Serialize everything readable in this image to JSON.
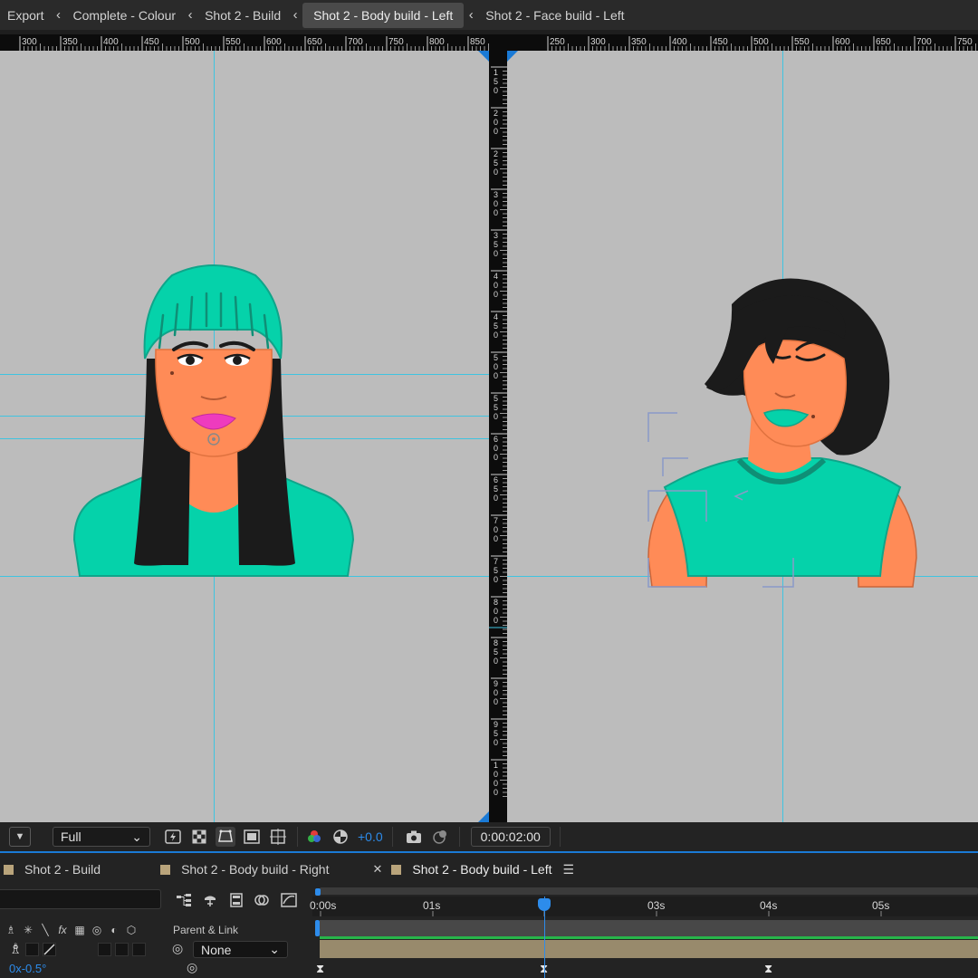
{
  "breadcrumbs": [
    {
      "label": "Export"
    },
    {
      "label": "Complete - Colour"
    },
    {
      "label": "Shot 2 - Build"
    },
    {
      "label": "Shot 2 - Body build - Left"
    },
    {
      "label": "Shot 2 - Face build - Left"
    }
  ],
  "rulers": {
    "left_top_ticks": [
      "300",
      "350",
      "400",
      "450",
      "500",
      "550",
      "600",
      "650",
      "700",
      "750",
      "800",
      "850"
    ],
    "right_top_ticks": [
      "250",
      "300",
      "350",
      "400",
      "450",
      "500",
      "550",
      "600",
      "650",
      "700",
      "750"
    ],
    "vertical_ticks": [
      "150",
      "200",
      "250",
      "300",
      "350",
      "400",
      "450",
      "500",
      "550",
      "600",
      "650",
      "700",
      "750",
      "800",
      "850",
      "900",
      "950",
      "1000"
    ]
  },
  "viewer_toolbar": {
    "resolution": "Full",
    "exposure": "+0.0",
    "timecode": "0:00:02:00"
  },
  "timeline": {
    "tabs": [
      {
        "label": "Shot 2 - Build"
      },
      {
        "label": "Shot 2 - Body build - Right"
      },
      {
        "label": "Shot 2 - Body build - Left"
      }
    ],
    "column_parent_label": "Parent & Link",
    "parent_value": "None",
    "rotation_value": "0x-0.5°",
    "time_ticks": [
      "0:00s",
      "01s",
      "03s",
      "04s",
      "05s"
    ]
  },
  "colors": {
    "accent": "#2d8ceb",
    "guide": "#3fc4e0",
    "canvas": "#bcbcbc",
    "teal": "#05d2aa",
    "skin": "#ff8b57",
    "hair": "#1b1b1b",
    "lips": "#ee3bbe",
    "layer_bar": "#988a6c"
  }
}
